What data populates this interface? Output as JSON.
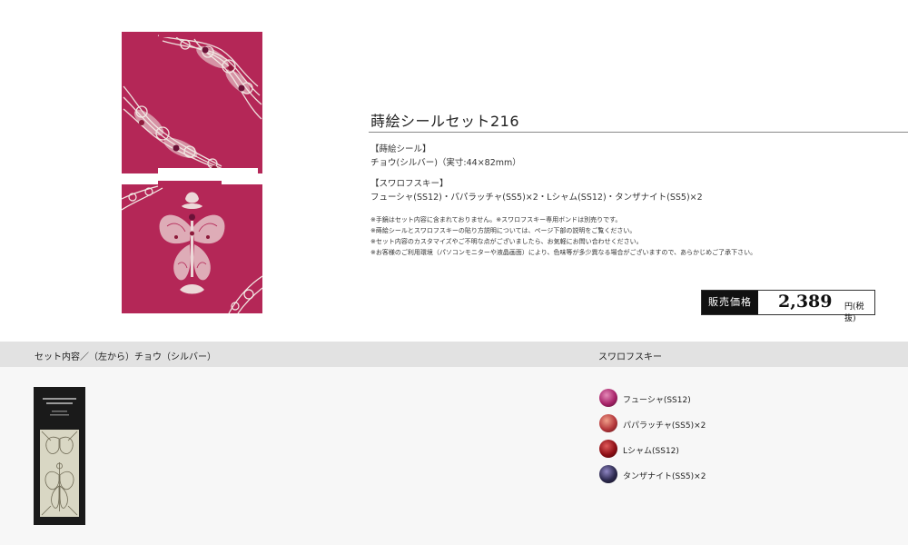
{
  "product": {
    "title": "蒔絵シールセット216",
    "maki_heading": "【蒔絵シール】",
    "maki_detail": "チョウ(シルバー)（実寸:44×82mm）",
    "swarovski_heading": "【スワロフスキー】",
    "swarovski_detail": "フューシャ(SS12)・パパラッチャ(SS5)×2・Lシャム(SS12)・タンザナイト(SS5)×2",
    "notes": [
      "※手鏡はセット内容に含まれておりません。※スワロフスキー専用ボンドは別売りです。",
      "※蒔絵シールとスワロフスキーの貼り方説明については、ページ下部の説明をご覧ください。",
      "※セット内容のカスタマイズやご不明な点がございましたら、お気軽にお問い合わせください。",
      "※お客様のご利用環境（パソコンモニターや液晶画面）により、色味等が多少異なる場合がございますので、あらかじめご了承下さい。"
    ]
  },
  "price": {
    "label": "販売価格",
    "value": "2,389",
    "unit": "円(税抜)"
  },
  "bottom": {
    "left_heading": "セット内容／（左から）チョウ（シルバー）",
    "right_heading": "スワロフスキー",
    "swarovski_items": [
      {
        "label": "フューシャ(SS12)",
        "color": "#a8246a"
      },
      {
        "label": "パパラッチャ(SS5)×2",
        "color": "#b5383c"
      },
      {
        "label": "Lシャム(SS12)",
        "color": "#8e0f16"
      },
      {
        "label": "タンザナイト(SS5)×2",
        "color": "#2d2a4f"
      }
    ]
  },
  "colors": {
    "card_background": "#b42757",
    "lace": "#f3ece6",
    "bar": "#e2e2e2"
  }
}
